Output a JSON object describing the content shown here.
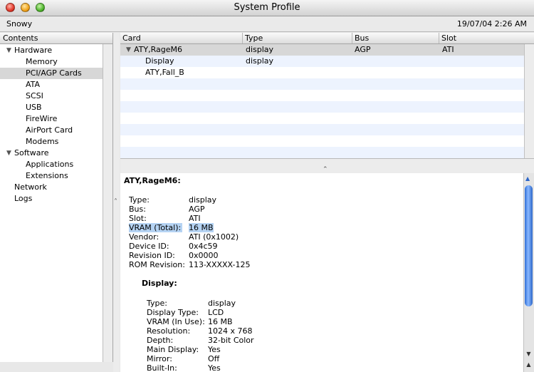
{
  "window": {
    "title": "System Profile",
    "computer_name": "Snowy",
    "timestamp": "19/07/04 2:26 AM"
  },
  "sidebar": {
    "header": "Contents",
    "items": [
      {
        "label": "Hardware",
        "level": 0,
        "expanded": true
      },
      {
        "label": "Memory",
        "level": 1
      },
      {
        "label": "PCI/AGP Cards",
        "level": 1,
        "selected": true
      },
      {
        "label": "ATA",
        "level": 1
      },
      {
        "label": "SCSI",
        "level": 1
      },
      {
        "label": "USB",
        "level": 1
      },
      {
        "label": "FireWire",
        "level": 1
      },
      {
        "label": "AirPort Card",
        "level": 1
      },
      {
        "label": "Modems",
        "level": 1
      },
      {
        "label": "Software",
        "level": 0,
        "expanded": true
      },
      {
        "label": "Applications",
        "level": 1
      },
      {
        "label": "Extensions",
        "level": 1
      },
      {
        "label": "Network",
        "level": 0
      },
      {
        "label": "Logs",
        "level": 0
      }
    ]
  },
  "table": {
    "columns": [
      "Card",
      "Type",
      "Bus",
      "Slot"
    ],
    "rows": [
      {
        "card": "ATY,RageM6",
        "type": "display",
        "bus": "AGP",
        "slot": "ATI",
        "expanded": true,
        "selected": true
      },
      {
        "card": "Display",
        "type": "display",
        "bus": "",
        "slot": ""
      },
      {
        "card": "ATY,Fall_B",
        "type": "",
        "bus": "",
        "slot": ""
      }
    ]
  },
  "detail": {
    "title": "ATY,RageM6:",
    "fields": [
      {
        "key": "Type:",
        "value": "display"
      },
      {
        "key": "Bus:",
        "value": "AGP"
      },
      {
        "key": "Slot:",
        "value": "ATI"
      },
      {
        "key": "VRAM (Total):",
        "value": "16 MB",
        "highlighted": true
      },
      {
        "key": "Vendor:",
        "value": "ATI (0x1002)"
      },
      {
        "key": "Device ID:",
        "value": "0x4c59"
      },
      {
        "key": "Revision ID:",
        "value": "0x0000"
      },
      {
        "key": "ROM Revision:",
        "value": "113-XXXXX-125"
      }
    ],
    "display": {
      "heading": "Display:",
      "fields": [
        {
          "key": "Type:",
          "value": "display"
        },
        {
          "key": "Display Type:",
          "value": "LCD"
        },
        {
          "key": "VRAM (In Use):",
          "value": "16 MB"
        },
        {
          "key": "Resolution:",
          "value": "1024 x 768"
        },
        {
          "key": "Depth:",
          "value": "32-bit Color"
        },
        {
          "key": "Main Display:",
          "value": "Yes"
        },
        {
          "key": "Mirror:",
          "value": "Off"
        },
        {
          "key": "Built-In:",
          "value": "Yes"
        }
      ]
    }
  },
  "colors": {
    "selection_gray": "#d7d7d7",
    "highlight_blue": "#b5d3f3",
    "stripe_blue": "#edf3fe",
    "scroll_blue": "#2f6fd6"
  }
}
